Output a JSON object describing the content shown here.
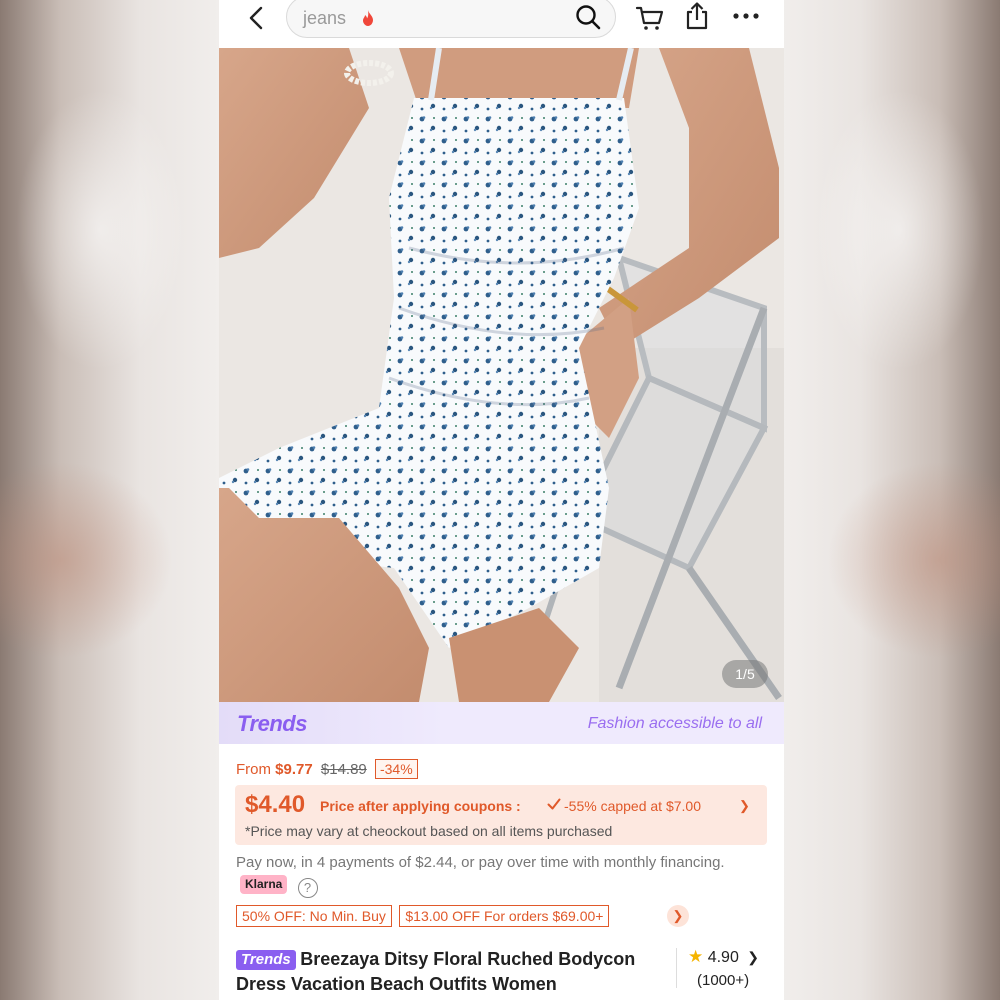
{
  "search": {
    "query": "jeans"
  },
  "gallery": {
    "counter": "1/5"
  },
  "banner": {
    "logo": "Trends",
    "slogan": "Fashion accessible to all"
  },
  "price": {
    "from_label": "From",
    "current": "$9.77",
    "original": "$14.89",
    "discount": "-34%"
  },
  "coupon": {
    "price": "$4.40",
    "label": "Price after applying coupons :",
    "cap": "-55% capped at $7.00",
    "note": "*Price may vary at cheockout based on all items purchased"
  },
  "klarna": {
    "text": "Pay now, in 4 payments of $2.44, or pay over time with monthly financing.",
    "badge": "Klarna"
  },
  "promos": [
    "50% OFF: No Min. Buy",
    "$13.00 OFF For orders $69.00+"
  ],
  "product": {
    "tag": "Trends",
    "title": "Breezaya Ditsy Floral Ruched Bodycon Dress Vacation Beach Outfits Women",
    "rating": "4.90",
    "rating_count": "(1000+)"
  },
  "colors": {
    "accent": "#e0592a",
    "trends": "#8a5ef0"
  }
}
